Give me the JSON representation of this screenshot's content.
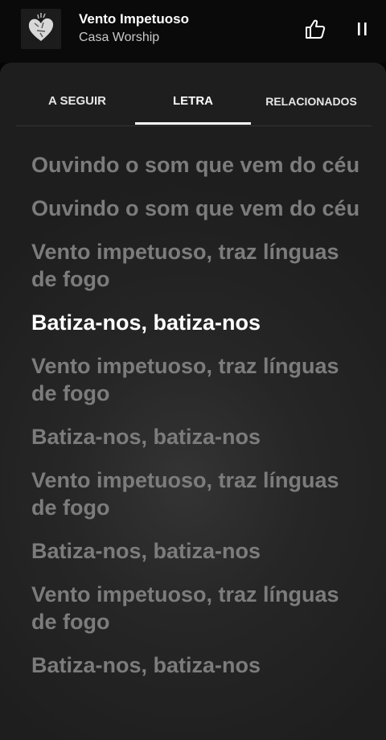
{
  "player": {
    "title": "Vento Impetuoso",
    "artist": "Casa Worship",
    "album_art_icon": "album-art-heart",
    "like_icon": "thumbs-up-icon",
    "pause_icon": "pause-icon"
  },
  "tabs": [
    {
      "label": "A SEGUIR"
    },
    {
      "label": "LETRA",
      "selected": true
    },
    {
      "label": "RELACIONADOS"
    }
  ],
  "lyrics": {
    "active_index": 3,
    "lines": [
      "Ouvindo o som que vem do céu",
      "Ouvindo o som que vem do céu",
      "Vento impetuoso, traz línguas de fogo",
      "Batiza-nos, batiza-nos",
      "Vento impetuoso, traz línguas de fogo",
      "Batiza-nos, batiza-nos",
      "Vento impetuoso, traz línguas de fogo",
      "Batiza-nos, batiza-nos",
      "Vento impetuoso, traz línguas de fogo",
      "Batiza-nos, batiza-nos"
    ]
  },
  "colors": {
    "background": "#050505",
    "sheet": "#262626",
    "lyric_inactive": "#7c7c7c",
    "lyric_active": "#ffffff",
    "tab_indicator": "#ffffff"
  }
}
